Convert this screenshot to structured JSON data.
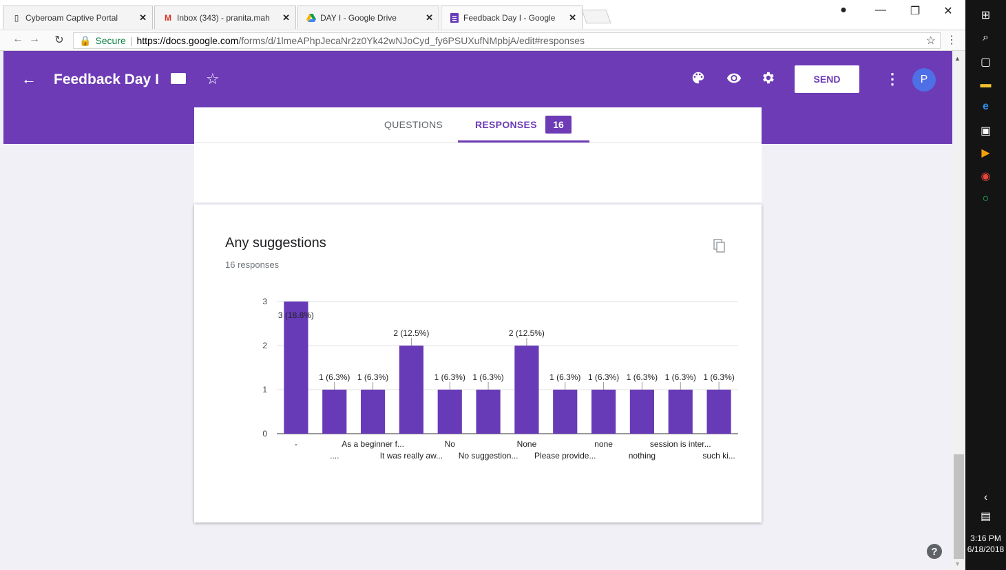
{
  "browser": {
    "tabs": [
      {
        "label": "Cyberoam Captive Portal",
        "icon": "page-icon"
      },
      {
        "label": "Inbox (343) - pranita.mah",
        "icon": "gmail-icon"
      },
      {
        "label": "DAY I - Google Drive",
        "icon": "drive-icon"
      },
      {
        "label": "Feedback Day I - Google",
        "icon": "forms-icon"
      }
    ],
    "secure_label": "Secure",
    "url_host": "https://docs.google.com",
    "url_path": "/forms/d/1lmeAPhpJecaNr2z0Yk42wNJoCyd_fy6PSUXufNMpbjA/edit#responses",
    "colors": {
      "accent": "#6c3bb5"
    }
  },
  "header": {
    "title": "Feedback Day I",
    "send_label": "SEND",
    "avatar_letter": "P"
  },
  "tabs": {
    "questions": "QUESTIONS",
    "responses": "RESPONSES",
    "responses_count": "16"
  },
  "question": {
    "title": "Any suggestions",
    "responses_text": "16 responses"
  },
  "chart_data": {
    "type": "bar",
    "categories": [
      "-",
      "....",
      "As a beginner f...",
      "It was really aw...",
      "No",
      "No suggestion...",
      "None",
      "Please provide...",
      "none",
      "nothing",
      "session is inter...",
      "such ki..."
    ],
    "values": [
      3,
      1,
      1,
      2,
      1,
      1,
      2,
      1,
      1,
      1,
      1,
      1
    ],
    "data_labels": [
      "3 (18.8%)",
      "1 (6.3%)",
      "1 (6.3%)",
      "2 (12.5%)",
      "1 (6.3%)",
      "1 (6.3%)",
      "2 (12.5%)",
      "1 (6.3%)",
      "1 (6.3%)",
      "1 (6.3%)",
      "1 (6.3%)",
      "1 (6.3%)"
    ],
    "yticks": [
      "0",
      "1",
      "2",
      "3"
    ],
    "ylim": [
      0,
      3
    ],
    "grid": true,
    "color": "#673ab7"
  },
  "taskbar": {
    "time": "3:16 PM",
    "date": "6/18/2018"
  }
}
